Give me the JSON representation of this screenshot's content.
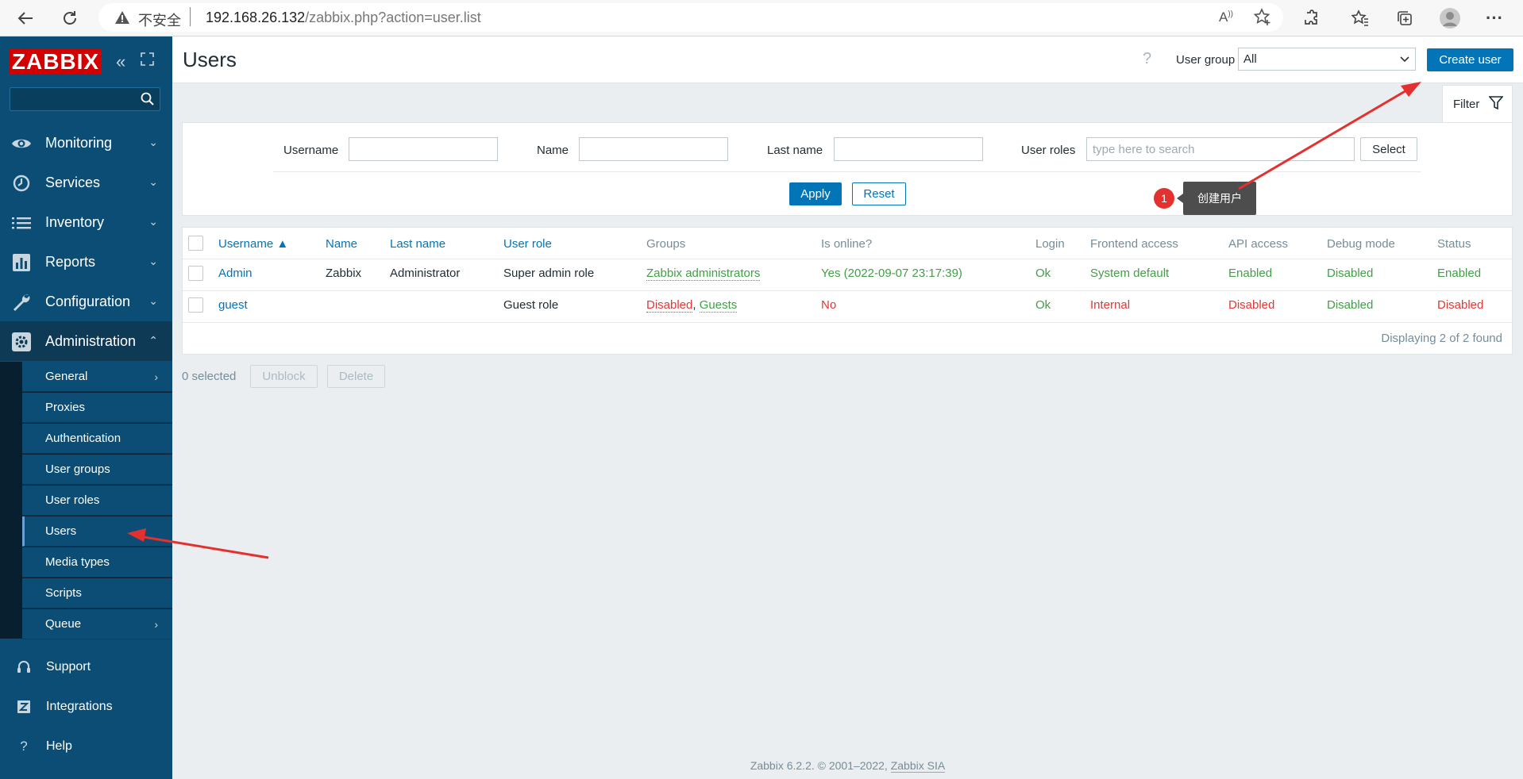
{
  "browser": {
    "insecure_label": "不安全",
    "url_host": "192.168.26.132",
    "url_path": "/zabbix.php?action=user.list"
  },
  "sidebar": {
    "logo": "ZABBIX",
    "search_placeholder": "",
    "menu": [
      {
        "label": "Monitoring",
        "icon": "eye-icon"
      },
      {
        "label": "Services",
        "icon": "clock-icon"
      },
      {
        "label": "Inventory",
        "icon": "list-icon"
      },
      {
        "label": "Reports",
        "icon": "bar-chart-icon"
      },
      {
        "label": "Configuration",
        "icon": "wrench-icon"
      },
      {
        "label": "Administration",
        "icon": "gear-icon"
      }
    ],
    "submenu": [
      {
        "label": "General",
        "has_arrow": true
      },
      {
        "label": "Proxies"
      },
      {
        "label": "Authentication"
      },
      {
        "label": "User groups"
      },
      {
        "label": "User roles"
      },
      {
        "label": "Users",
        "active": true
      },
      {
        "label": "Media types"
      },
      {
        "label": "Scripts"
      },
      {
        "label": "Queue",
        "has_arrow": true
      }
    ],
    "bottom": [
      {
        "label": "Support",
        "icon": "headset-icon"
      },
      {
        "label": "Integrations",
        "icon": "zabbix-z-icon"
      },
      {
        "label": "Help",
        "icon": "question-icon"
      }
    ]
  },
  "header": {
    "title": "Users",
    "user_group_label": "User group",
    "user_group_value": "All",
    "create_user_label": "Create user"
  },
  "filter": {
    "tab_label": "Filter",
    "username_label": "Username",
    "username_value": "",
    "name_label": "Name",
    "name_value": "",
    "lastname_label": "Last name",
    "lastname_value": "",
    "user_roles_label": "User roles",
    "user_roles_placeholder": "type here to search",
    "select_label": "Select",
    "apply_label": "Apply",
    "reset_label": "Reset"
  },
  "table": {
    "headers": [
      "Username ▲",
      "Name",
      "Last name",
      "User role",
      "Groups",
      "Is online?",
      "Login",
      "Frontend access",
      "API access",
      "Debug mode",
      "Status"
    ],
    "rows": [
      {
        "username": "Admin",
        "name": "Zabbix",
        "last_name": "Administrator",
        "user_role": "Super admin role",
        "groups": "Zabbix administrators",
        "groups_extra": "",
        "online": "Yes (2022-09-07 23:17:39)",
        "login": "Ok",
        "frontend": "System default",
        "api": "Enabled",
        "debug": "Disabled",
        "status": "Enabled"
      },
      {
        "username": "guest",
        "name": "",
        "last_name": "",
        "user_role": "Guest role",
        "groups": "Disabled",
        "groups_extra": "Guests",
        "online": "No",
        "login": "Ok",
        "frontend": "Internal",
        "api": "Disabled",
        "debug": "Disabled",
        "status": "Disabled"
      }
    ],
    "display_count": "Displaying 2 of 2 found"
  },
  "actions": {
    "selected_count": "0 selected",
    "unblock_label": "Unblock",
    "delete_label": "Delete"
  },
  "annotation": {
    "badge": "1",
    "tooltip": "创建用户"
  },
  "footer": {
    "text": "Zabbix 6.2.2. © 2001–2022, ",
    "link": "Zabbix SIA"
  },
  "colors": {
    "sidebar": "#0b4d74",
    "accent": "#0275b8",
    "logo_red": "#d40000",
    "ok_green": "#429e47",
    "alert_red": "#e33734",
    "annotation_arrow": "#e53030"
  }
}
